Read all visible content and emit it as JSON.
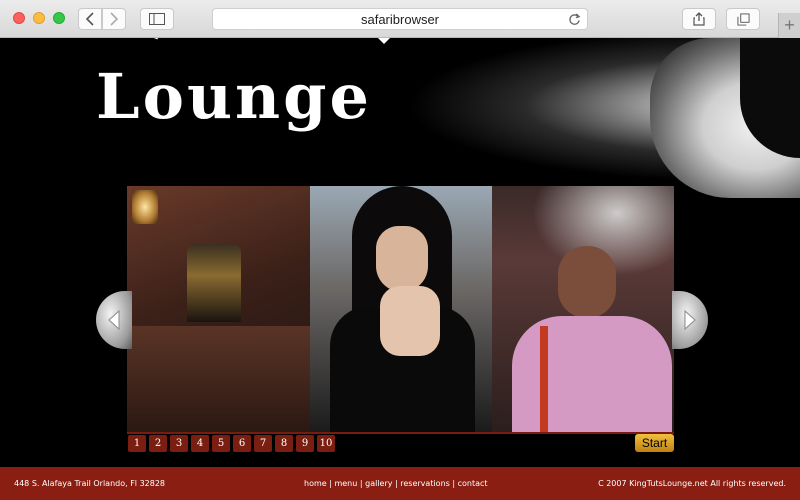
{
  "browser": {
    "url": "safaribrowser"
  },
  "site": {
    "logo_text": "Lounge"
  },
  "slideshow": {
    "pages": [
      "1",
      "2",
      "3",
      "4",
      "5",
      "6",
      "7",
      "8",
      "9",
      "10"
    ],
    "start_label": "Start"
  },
  "footer": {
    "address": "448 S. Alafaya Trail Orlando, Fl 32828",
    "nav": [
      {
        "label": "home"
      },
      {
        "label": "menu"
      },
      {
        "label": "gallery"
      },
      {
        "label": "reservations"
      },
      {
        "label": "contact"
      }
    ],
    "separator": " | ",
    "copyright": "C 2007 KingTutsLounge.net All rights reserved."
  },
  "colors": {
    "footer_bg": "#8b1e12",
    "pager_bg": "#7a1e12",
    "start_bg": "#e0a020"
  }
}
